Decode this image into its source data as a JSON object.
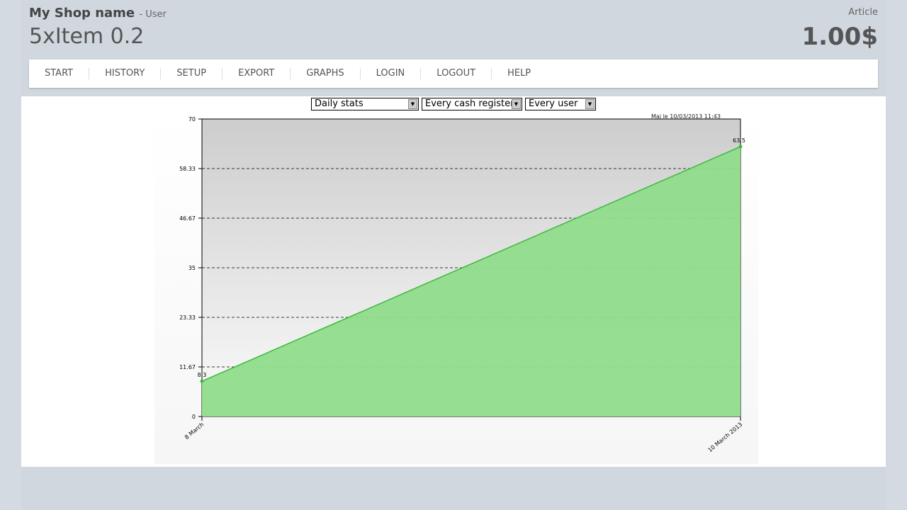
{
  "header": {
    "shop_name": "My Shop name",
    "user": "- User",
    "item": "5xItem 0.2",
    "article_label": "Article",
    "price": "1.00$"
  },
  "nav": [
    "START",
    "HISTORY",
    "SETUP",
    "EXPORT",
    "GRAPHS",
    "LOGIN",
    "LOGOUT",
    "HELP"
  ],
  "filters": {
    "period": "Daily stats",
    "register": "Every cash register",
    "user": "Every user"
  },
  "chart_data": {
    "type": "area",
    "updated": "Maj le 10/03/2013 11:43",
    "categories": [
      "8 March",
      "10 March 2013"
    ],
    "values": [
      8.3,
      63.5
    ],
    "value_labels": [
      "8.3",
      "63.5"
    ],
    "ylim": [
      0,
      70
    ],
    "yticks": [
      "0",
      "11.67",
      "23.33",
      "35",
      "46.67",
      "58.33",
      "70"
    ],
    "grid": true,
    "colors": {
      "fill": "#8fdc8c",
      "line": "#3fb83f"
    }
  }
}
